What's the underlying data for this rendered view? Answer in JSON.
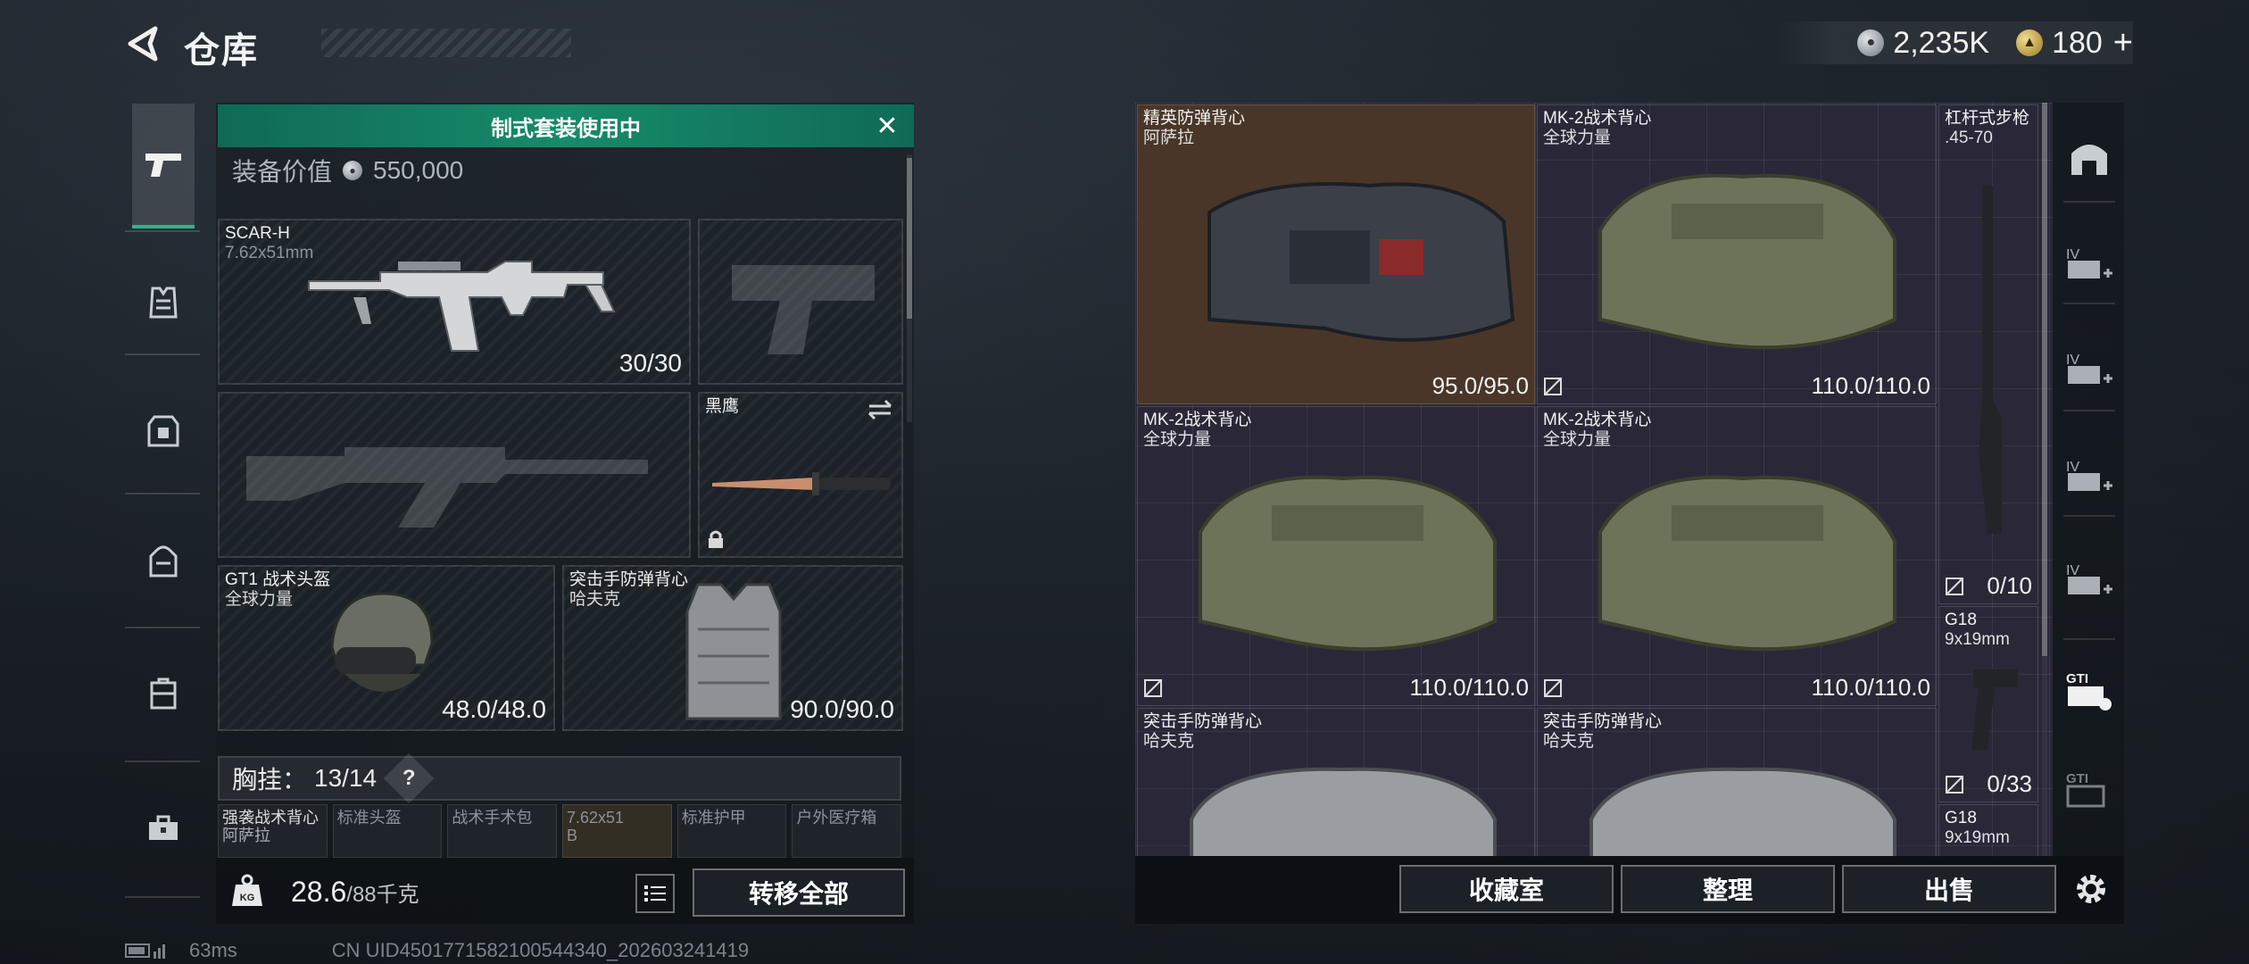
{
  "header": {
    "title": "仓库",
    "currency": [
      {
        "icon": "silver-coin-icon",
        "amount": "2,235K"
      },
      {
        "icon": "gold-coin-icon",
        "amount": "180"
      }
    ],
    "add_label": "+"
  },
  "loadout": {
    "banner": "制式套装使用中",
    "value_label": "装备价值",
    "value": "550,000",
    "primary": {
      "name": "SCAR-H",
      "sub": "7.62x51mm",
      "ammo": "30/30"
    },
    "melee": {
      "name": "黑鹰"
    },
    "helmet": {
      "name": "GT1 战术头盔",
      "sub": "全球力量",
      "durability": "48.0/48.0"
    },
    "armor": {
      "name": "突击手防弹背心",
      "sub": "哈夫克",
      "durability": "90.0/90.0"
    },
    "chest_label": "胸挂：",
    "chest_count": "13/14",
    "help": "?",
    "mini_slots": [
      {
        "a": "强袭战术背心",
        "b": "阿萨拉"
      },
      {
        "a": "标准头盔",
        "b": ""
      },
      {
        "a": "战术手术包",
        "b": ""
      },
      {
        "a": "7.62x51",
        "b": "B"
      },
      {
        "a": "标准护甲",
        "b": ""
      },
      {
        "a": "户外医疗箱",
        "b": ""
      }
    ],
    "weight": "28.6",
    "weight_max": "/88千克",
    "transfer_label": "转移全部"
  },
  "stash": {
    "items": [
      {
        "n1": "精英防弹背心",
        "n2": "阿萨拉",
        "dur": "95.0/95.0"
      },
      {
        "n1": "MK-2战术背心",
        "n2": "全球力量",
        "dur": "110.0/110.0"
      },
      {
        "n1": "杠杆式步枪",
        "n2": ".45-70",
        "dur": "0/10"
      },
      {
        "n1": "MK-2战术背心",
        "n2": "全球力量",
        "dur": "110.0/110.0"
      },
      {
        "n1": "MK-2战术背心",
        "n2": "全球力量",
        "dur": "110.0/110.0"
      },
      {
        "n1": "G18",
        "n2": "9x19mm",
        "dur": "0/33"
      },
      {
        "n1": "突击手防弹背心",
        "n2": "哈夫克",
        "dur": ""
      },
      {
        "n1": "突击手防弹背心",
        "n2": "哈夫克",
        "dur": ""
      },
      {
        "n1": "G18",
        "n2": "9x19mm",
        "dur": ""
      }
    ],
    "buttons": {
      "collection": "收藏室",
      "sort": "整理",
      "sell": "出售"
    }
  },
  "status": {
    "ping": "63ms",
    "uid": "CN UID4501771582100544340_202603241419"
  }
}
